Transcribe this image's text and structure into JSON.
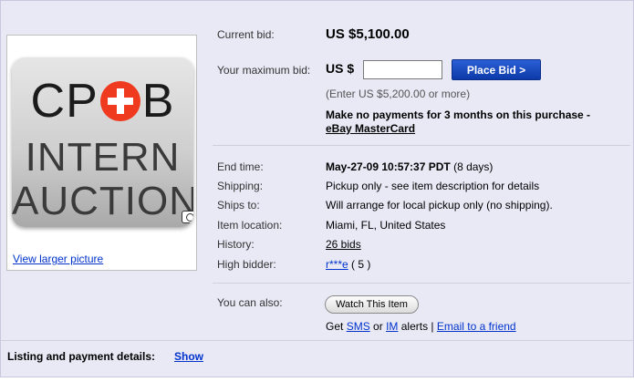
{
  "image": {
    "logo_line1_left": "CP",
    "logo_line1_right": "B",
    "logo_line2": "INTERN",
    "logo_line3": "AUCTION",
    "view_larger_label": "View larger picture"
  },
  "bid": {
    "current_bid_label": "Current bid:",
    "current_bid_value": "US $5,100.00",
    "max_bid_label": "Your maximum bid:",
    "max_bid_currency": "US $",
    "max_bid_input_value": "",
    "place_bid_label": "Place Bid >",
    "hint": "(Enter US $5,200.00 or more)",
    "promo_text": "Make no payments for 3 months on this purchase -",
    "promo_link": "eBay MasterCard"
  },
  "details": {
    "end_time_label": "End time:",
    "end_time_value": "May-27-09 10:57:37 PDT",
    "end_time_remaining": "(8 days)",
    "shipping_label": "Shipping:",
    "shipping_value": "Pickup only - see item description for details",
    "ships_to_label": "Ships to:",
    "ships_to_value": "Will arrange for local pickup only (no shipping).",
    "location_label": "Item location:",
    "location_value": "Miami, FL, United States",
    "history_label": "History:",
    "history_value": "26 bids",
    "high_bidder_label": "High bidder:",
    "high_bidder_value": "r***e",
    "high_bidder_score": "( 5 )"
  },
  "actions": {
    "you_can_also_label": "You can also:",
    "watch_label": "Watch This Item",
    "get_text": "Get",
    "sms_link": "SMS",
    "or_text": "or",
    "im_link": "IM",
    "alerts_text": "alerts |",
    "email_link": "Email to a friend"
  },
  "footer": {
    "label": "Listing and payment details:",
    "show_link": "Show"
  },
  "colors": {
    "panel_bg": "#e9e9f6",
    "link": "#0033cc",
    "place_bid_bg": "#0d3aa8",
    "logo_plus": "#ef3a1f"
  }
}
